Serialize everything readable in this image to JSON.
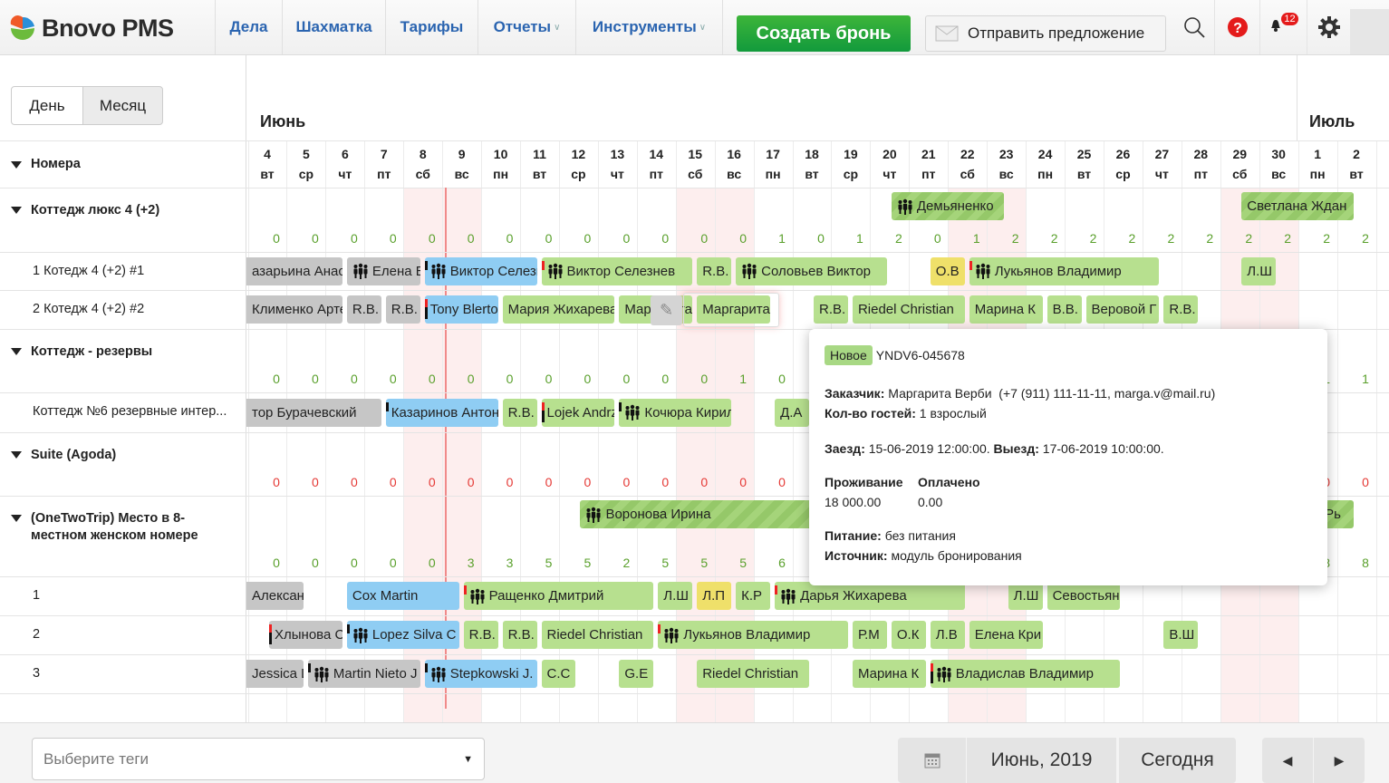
{
  "app": {
    "name": "Bnovo PMS",
    "logo_colors": [
      "#f05a28",
      "#2a8fd8",
      "#6cbb3c"
    ]
  },
  "nav": {
    "items": [
      {
        "label": "Дела",
        "dropdown": false
      },
      {
        "label": "Шахматка",
        "dropdown": false
      },
      {
        "label": "Тарифы",
        "dropdown": false
      },
      {
        "label": "Отчеты",
        "dropdown": true
      },
      {
        "label": "Инструменты",
        "dropdown": true
      }
    ],
    "create_label": "Создать бронь",
    "offer_label": "Отправить предложение",
    "notifications": "12",
    "icons": [
      "search-icon",
      "help-icon",
      "bell-icon",
      "gear-icon"
    ]
  },
  "view": {
    "day": "День",
    "month": "Месяц",
    "active": "Месяц"
  },
  "months": [
    "Июнь",
    "Июль"
  ],
  "days": [
    [
      "4",
      "вт"
    ],
    [
      "5",
      "ср"
    ],
    [
      "6",
      "чт"
    ],
    [
      "7",
      "пт"
    ],
    [
      "8",
      "сб"
    ],
    [
      "9",
      "вс"
    ],
    [
      "10",
      "пн"
    ],
    [
      "11",
      "вт"
    ],
    [
      "12",
      "ср"
    ],
    [
      "13",
      "чт"
    ],
    [
      "14",
      "пт"
    ],
    [
      "15",
      "сб"
    ],
    [
      "16",
      "вс"
    ],
    [
      "17",
      "пн"
    ],
    [
      "18",
      "вт"
    ],
    [
      "19",
      "ср"
    ],
    [
      "20",
      "чт"
    ],
    [
      "21",
      "пт"
    ],
    [
      "22",
      "сб"
    ],
    [
      "23",
      "вс"
    ],
    [
      "24",
      "пн"
    ],
    [
      "25",
      "вт"
    ],
    [
      "26",
      "ср"
    ],
    [
      "27",
      "чт"
    ],
    [
      "28",
      "пт"
    ],
    [
      "29",
      "сб"
    ],
    [
      "30",
      "вс"
    ],
    [
      "1",
      "пн"
    ],
    [
      "2",
      "вт"
    ]
  ],
  "rooms_header": "Номера",
  "colors": {
    "green": "#b7e08f",
    "gray": "#c6c6c6",
    "blue": "#8fcdf3",
    "yellow": "#efe06a",
    "count_ok": "#5aa02c",
    "count_zero": "#e53935"
  },
  "rows": [
    {
      "type": "group",
      "label": "Коттедж люкс 4 (+2)",
      "count_color": "count_ok",
      "counts": [
        0,
        0,
        0,
        0,
        0,
        0,
        0,
        0,
        0,
        0,
        0,
        0,
        0,
        1,
        0,
        1,
        2,
        0,
        1,
        2,
        2,
        2,
        2,
        2,
        2,
        2,
        2,
        2,
        2
      ],
      "bookings": [
        {
          "name": "Демьяненко",
          "start": "06-20",
          "end": "06-23",
          "color": "striped",
          "icon": true
        },
        {
          "name": "Светлана Ждан",
          "start": "06-29",
          "end": "07-02",
          "color": "striped"
        }
      ]
    },
    {
      "type": "room",
      "label": "1 Котедж 4 (+2) #1",
      "bookings": [
        {
          "name": "азарьина Анас",
          "start": "06-02",
          "end": "06-06",
          "color": "gray"
        },
        {
          "name": "Елена Б",
          "start": "06-06",
          "end": "06-08",
          "color": "gray",
          "icon": true
        },
        {
          "name": "Виктор Селезнев",
          "start": "06-08",
          "end": "06-11",
          "color": "blue",
          "icon": true,
          "marker": "black"
        },
        {
          "name": "Виктор Селезнев",
          "start": "06-11",
          "end": "06-15",
          "color": "green",
          "icon": true,
          "marker": "red"
        },
        {
          "name": "R.B.",
          "start": "06-15",
          "end": "06-16",
          "color": "green"
        },
        {
          "name": "Соловьев Виктор",
          "start": "06-16",
          "end": "06-20",
          "color": "green",
          "icon": true
        },
        {
          "name": "О.В",
          "start": "06-21",
          "end": "06-22",
          "color": "yellow"
        },
        {
          "name": "Лукьянов Владимир",
          "start": "06-22",
          "end": "06-27",
          "color": "green",
          "icon": true,
          "marker": "red"
        },
        {
          "name": "Л.Ш",
          "start": "06-29",
          "end": "06-30",
          "color": "green"
        }
      ]
    },
    {
      "type": "room",
      "label": "2 Котедж 4 (+2) #2",
      "bookings": [
        {
          "name": "Клименко Артем",
          "start": "06-02",
          "end": "06-06",
          "color": "gray"
        },
        {
          "name": "R.B.",
          "start": "06-06",
          "end": "06-07",
          "color": "gray"
        },
        {
          "name": "R.B.",
          "start": "06-07",
          "end": "06-08",
          "color": "gray"
        },
        {
          "name": "Tony Blerton",
          "start": "06-08",
          "end": "06-10",
          "color": "blue",
          "marker": "redblack"
        },
        {
          "name": "Мария Жихарева",
          "start": "06-10",
          "end": "06-13",
          "color": "green"
        },
        {
          "name": "Маргарита",
          "start": "06-13",
          "end": "06-15",
          "color": "green"
        },
        {
          "name": "Маргарита Верби",
          "start": "06-15",
          "end": "06-17",
          "color": "green",
          "selected": true
        },
        {
          "name": "R.B.",
          "start": "06-18",
          "end": "06-19",
          "color": "green"
        },
        {
          "name": "Riedel Christian",
          "start": "06-19",
          "end": "06-22",
          "color": "green"
        },
        {
          "name": "Марина К",
          "start": "06-22",
          "end": "06-24",
          "color": "green"
        },
        {
          "name": "В.В.",
          "start": "06-24",
          "end": "06-25",
          "color": "green"
        },
        {
          "name": "Веровой Г",
          "start": "06-25",
          "end": "06-27",
          "color": "green"
        },
        {
          "name": "R.B.",
          "start": "06-27",
          "end": "06-28",
          "color": "green"
        }
      ]
    },
    {
      "type": "group",
      "label": "Коттедж - резервы",
      "count_color": "count_ok",
      "counts": [
        0,
        0,
        0,
        0,
        0,
        0,
        0,
        0,
        0,
        0,
        0,
        0,
        1,
        0,
        null,
        null,
        null,
        null,
        null,
        null,
        null,
        null,
        null,
        null,
        null,
        null,
        null,
        1,
        1
      ],
      "bookings": []
    },
    {
      "type": "room",
      "label": "Коттедж №6 резервные интер...",
      "bookings": [
        {
          "name": "тор Бурачевский",
          "start": "06-02",
          "end": "06-07",
          "color": "gray"
        },
        {
          "name": "Казаринов Антон",
          "start": "06-07",
          "end": "06-10",
          "color": "blue",
          "marker": "black"
        },
        {
          "name": "R.B.",
          "start": "06-10",
          "end": "06-11",
          "color": "green"
        },
        {
          "name": "Lojek Andrzej",
          "start": "06-11",
          "end": "06-13",
          "color": "green",
          "marker": "redblack"
        },
        {
          "name": "Кочюра Кирилл",
          "start": "06-13",
          "end": "06-16",
          "color": "green",
          "icon": true,
          "marker": "black"
        },
        {
          "name": "Д.А",
          "start": "06-17",
          "end": "06-18",
          "color": "green"
        }
      ]
    },
    {
      "type": "group",
      "label": "Suite (Agoda)",
      "count_color": "count_zero",
      "counts": [
        0,
        0,
        0,
        0,
        0,
        0,
        0,
        0,
        0,
        0,
        0,
        0,
        0,
        0,
        null,
        null,
        null,
        null,
        null,
        null,
        null,
        null,
        null,
        null,
        null,
        null,
        null,
        0,
        0
      ],
      "bookings": []
    },
    {
      "type": "group",
      "label": "(OneTwoTrip) Место в 8-местном женском номере",
      "count_color": "count_ok",
      "counts": [
        0,
        0,
        0,
        0,
        0,
        3,
        3,
        5,
        5,
        2,
        5,
        5,
        5,
        6,
        null,
        null,
        null,
        null,
        null,
        null,
        null,
        null,
        null,
        null,
        null,
        null,
        null,
        8,
        8
      ],
      "bookings": [
        {
          "name": "Воронова Ирина",
          "start": "06-12",
          "end": "06-19",
          "color": "striped",
          "icon": true
        },
        {
          "name": "Рь",
          "start": "07-01",
          "end": "07-02",
          "color": "striped"
        }
      ]
    },
    {
      "type": "room",
      "label": "1",
      "bookings": [
        {
          "name": "Александр",
          "start": "06-02",
          "end": "06-05",
          "color": "gray"
        },
        {
          "name": "Cox Martin",
          "start": "06-06",
          "end": "06-09",
          "color": "blue"
        },
        {
          "name": "Ращенко Дмитрий",
          "start": "06-09",
          "end": "06-14",
          "color": "green",
          "icon": true,
          "marker": "red"
        },
        {
          "name": "Л.Ш",
          "start": "06-14",
          "end": "06-15",
          "color": "green"
        },
        {
          "name": "Л.П",
          "start": "06-15",
          "end": "06-16",
          "color": "yellow"
        },
        {
          "name": "К.Р",
          "start": "06-16",
          "end": "06-17",
          "color": "green"
        },
        {
          "name": "Дарья Жихарева",
          "start": "06-17",
          "end": "06-22",
          "color": "green",
          "icon": true,
          "marker": "red"
        },
        {
          "name": "Л.Ш",
          "start": "06-23",
          "end": "06-24",
          "color": "green"
        },
        {
          "name": "Севостьянов",
          "start": "06-24",
          "end": "06-26",
          "color": "green"
        }
      ]
    },
    {
      "type": "room",
      "label": "2",
      "bookings": [
        {
          "name": "Хлынова С",
          "start": "06-04",
          "end": "06-06",
          "color": "gray",
          "marker": "redblack"
        },
        {
          "name": "Lopez Silva C",
          "start": "06-06",
          "end": "06-09",
          "color": "blue",
          "icon": true,
          "marker": "black"
        },
        {
          "name": "R.B.",
          "start": "06-09",
          "end": "06-10",
          "color": "green"
        },
        {
          "name": "R.B.",
          "start": "06-10",
          "end": "06-11",
          "color": "green"
        },
        {
          "name": "Riedel Christian",
          "start": "06-11",
          "end": "06-14",
          "color": "green"
        },
        {
          "name": "Лукьянов Владимир",
          "start": "06-14",
          "end": "06-19",
          "color": "green",
          "icon": true,
          "marker": "red"
        },
        {
          "name": "Р.М",
          "start": "06-19",
          "end": "06-20",
          "color": "green"
        },
        {
          "name": "О.К",
          "start": "06-20",
          "end": "06-21",
          "color": "green"
        },
        {
          "name": "Л.В",
          "start": "06-21",
          "end": "06-22",
          "color": "green"
        },
        {
          "name": "Елена Кри",
          "start": "06-22",
          "end": "06-24",
          "color": "green"
        },
        {
          "name": "В.Ш",
          "start": "06-27",
          "end": "06-28",
          "color": "green"
        }
      ]
    },
    {
      "type": "room",
      "label": "3",
      "bookings": [
        {
          "name": "Jessica L",
          "start": "06-02",
          "end": "06-05",
          "color": "gray"
        },
        {
          "name": "Martin Nieto J",
          "start": "06-05",
          "end": "06-08",
          "color": "gray",
          "icon": true,
          "marker": "black"
        },
        {
          "name": "Stepkowski J.",
          "start": "06-08",
          "end": "06-11",
          "color": "blue",
          "icon": true,
          "marker": "black"
        },
        {
          "name": "С.С",
          "start": "06-11",
          "end": "06-12",
          "color": "green"
        },
        {
          "name": "G.E",
          "start": "06-13",
          "end": "06-14",
          "color": "green"
        },
        {
          "name": "Riedel Christian",
          "start": "06-15",
          "end": "06-18",
          "color": "green"
        },
        {
          "name": "Марина К",
          "start": "06-19",
          "end": "06-21",
          "color": "green"
        },
        {
          "name": "Владислав Владимир",
          "start": "06-21",
          "end": "06-26",
          "color": "green",
          "icon": true,
          "marker": "redblack"
        }
      ]
    },
    {
      "type": "room",
      "label": "",
      "bookings": []
    }
  ],
  "tooltip": {
    "status": "Новое",
    "code": "YNDV6-045678",
    "customer_label": "Заказчик:",
    "customer": "Маргарита Верби  (+7 (911) 111-11-11, marga.v@mail.ru)",
    "guests_label": "Кол-во гостей:",
    "guests": "1 взрослый",
    "checkin_label": "Заезд:",
    "checkin": "15-06-2019 12:00:00.",
    "checkout_label": "Выезд:",
    "checkout": "17-06-2019 10:00:00.",
    "stay_label": "Проживание",
    "stay": "18 000.00",
    "paid_label": "Оплачено",
    "paid": "0.00",
    "meal_label": "Питание:",
    "meal": "без питания",
    "source_label": "Источник:",
    "source": "модуль бронирования"
  },
  "footer": {
    "tags_placeholder": "Выберите теги",
    "period": "Июнь, 2019",
    "today": "Сегодня"
  }
}
